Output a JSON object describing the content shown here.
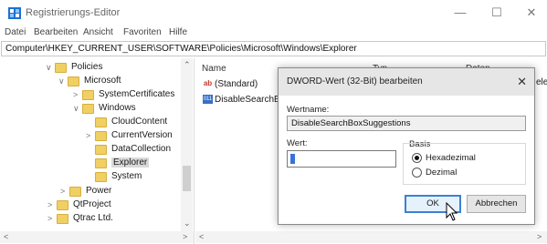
{
  "window": {
    "title": "Registrierungs-Editor",
    "min_glyph": "—",
    "max_glyph": "☐",
    "close_glyph": "✕"
  },
  "menu": [
    "Datei",
    "Bearbeiten",
    "Ansicht",
    "Favoriten",
    "Hilfe"
  ],
  "address": "Computer\\HKEY_CURRENT_USER\\SOFTWARE\\Policies\\Microsoft\\Windows\\Explorer",
  "tree": [
    {
      "label": "Policies",
      "chev": "∨"
    },
    {
      "label": "Microsoft",
      "chev": "∨"
    },
    {
      "label": "SystemCertificates",
      "chev": ">"
    },
    {
      "label": "Windows",
      "chev": "∨"
    },
    {
      "label": "CloudContent",
      "chev": ""
    },
    {
      "label": "CurrentVersion",
      "chev": ">"
    },
    {
      "label": "DataCollection",
      "chev": ""
    },
    {
      "label": "Explorer",
      "chev": "",
      "selected": true
    },
    {
      "label": "System",
      "chev": ""
    },
    {
      "label": "Power",
      "chev": ">"
    },
    {
      "label": "QtProject",
      "chev": ">"
    },
    {
      "label": "Qtrac Ltd.",
      "chev": ">"
    }
  ],
  "list": {
    "col_name": "Name",
    "col_type": "Typ",
    "col_data": "Daten",
    "col_data_overflow": "eleg",
    "rows": [
      {
        "icon": "ab",
        "name": "(Standard)"
      },
      {
        "icon": "011",
        "name": "DisableSearchBo"
      }
    ]
  },
  "dialog": {
    "title": "DWORD-Wert (32-Bit) bearbeiten",
    "close_glyph": "✕",
    "name_label": "Wertname:",
    "name_value": "DisableSearchBoxSuggestions",
    "value_label": "Wert:",
    "value_value": "",
    "basis_label": "Basis",
    "radio_hex": "Hexadezimal",
    "radio_dec": "Dezimal",
    "basis_selected": "Hexadezimal",
    "ok_label": "OK",
    "cancel_label": "Abbrechen"
  },
  "colors": {
    "folder": "#f0cf63",
    "accent": "#3c7fd1",
    "selection": "#d9d9d9"
  }
}
